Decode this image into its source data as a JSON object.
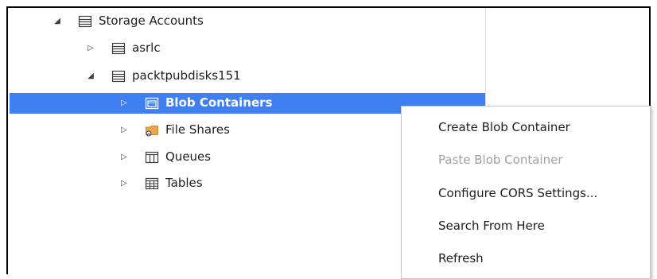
{
  "tree": {
    "storage_accounts": {
      "label": "Storage Accounts",
      "icon": "storage-list-icon",
      "expanded": true
    },
    "asrlc": {
      "label": "asrlc",
      "icon": "storage-list-icon",
      "expanded": false
    },
    "packt": {
      "label": "packtpubdisks151",
      "icon": "storage-list-icon",
      "expanded": true
    },
    "blob": {
      "label": "Blob Containers",
      "icon": "blob-container-icon",
      "selected": true
    },
    "files": {
      "label": "File Shares",
      "icon": "file-share-icon"
    },
    "queues": {
      "label": "Queues",
      "icon": "queue-icon"
    },
    "tables": {
      "label": "Tables",
      "icon": "table-icon"
    }
  },
  "context_menu": {
    "items": [
      {
        "label": "Create Blob Container",
        "enabled": true
      },
      {
        "label": "Paste Blob Container",
        "enabled": false
      },
      {
        "label": "Configure CORS Settings...",
        "enabled": true
      },
      {
        "label": "Search From Here",
        "enabled": true
      },
      {
        "label": "Refresh",
        "enabled": true
      }
    ]
  },
  "colors": {
    "selection": "#3f7ff2",
    "disabled_text": "#a0a0a0",
    "frame_border": "#000000"
  }
}
